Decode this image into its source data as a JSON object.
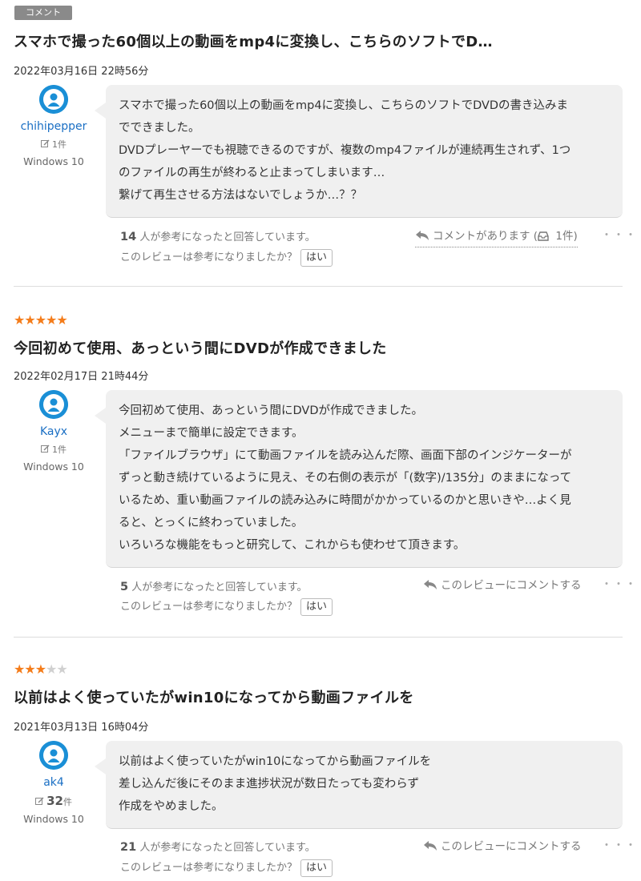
{
  "reviews": [
    {
      "badge": "コメント",
      "title": "スマホで撮った60個以上の動画をmp4に変換し、こちらのソフトでD…",
      "date": "2022年03月16日 22時56分",
      "user": {
        "name": "chihipepper",
        "count": "1",
        "count_unit": "件",
        "os": "Windows 10"
      },
      "body": [
        "スマホで撮った60個以上の動画をmp4に変換し、こちらのソフトでDVDの書き込みま",
        "でできました。",
        "DVDプレーヤーでも視聴できるのですが、複数のmp4ファイルが連続再生されず、1つ",
        "のファイルの再生が終わると止まってしまいます…",
        "繋げて再生させる方法はないでしょうか…？？"
      ],
      "helpful_count": "14",
      "helpful_text": "人が参考になったと回答しています。",
      "ask_text": "このレビューは参考になりましたか？",
      "yes_label": "はい",
      "comment_link": "コメントがあります (",
      "comment_link_count": " 1件)",
      "more": "・・・"
    },
    {
      "rating": 5,
      "title": "今回初めて使用、あっという間にDVDが作成できました",
      "date": "2022年02月17日 21時44分",
      "user": {
        "name": "Kayx",
        "count": "1",
        "count_unit": "件",
        "os": "Windows 10"
      },
      "body": [
        "今回初めて使用、あっという間にDVDが作成できました。",
        "メニューまで簡単に設定できます。",
        "「ファイルブラウザ」にて動画ファイルを読み込んだ際、画面下部のインジケーターが",
        "ずっと動き続けているように見え、その右側の表示が「(数字)/135分」のままになって",
        "いるため、重い動画ファイルの読み込みに時間がかかっているのかと思いきや…よく見",
        "ると、とっくに終わっていました。",
        "いろいろな機能をもっと研究して、これからも使わせて頂きます。"
      ],
      "helpful_count": "5",
      "helpful_text": "人が参考になったと回答しています。",
      "ask_text": "このレビューは参考になりましたか？",
      "yes_label": "はい",
      "comment_link": "このレビューにコメントする",
      "more": "・・・"
    },
    {
      "rating": 3,
      "title": "以前はよく使っていたがwin10になってから動画ファイルを",
      "date": "2021年03月13日 16時04分",
      "user": {
        "name": "ak4",
        "count": "32",
        "count_unit": "件",
        "os": "Windows 10"
      },
      "body": [
        "以前はよく使っていたがwin10になってから動画ファイルを",
        "差し込んだ後にそのまま進捗状況が数日たっても変わらず",
        "作成をやめました。"
      ],
      "helpful_count": "21",
      "helpful_text": "人が参考になったと回答しています。",
      "ask_text": "このレビューは参考になりましたか？",
      "yes_label": "はい",
      "comment_link": "このレビューにコメントする",
      "more": "・・・"
    }
  ],
  "colors": {
    "star": "#f47c1a",
    "star_empty": "#d0d0d0",
    "link": "#1a6fc4",
    "avatar": "#1a8fd6"
  }
}
